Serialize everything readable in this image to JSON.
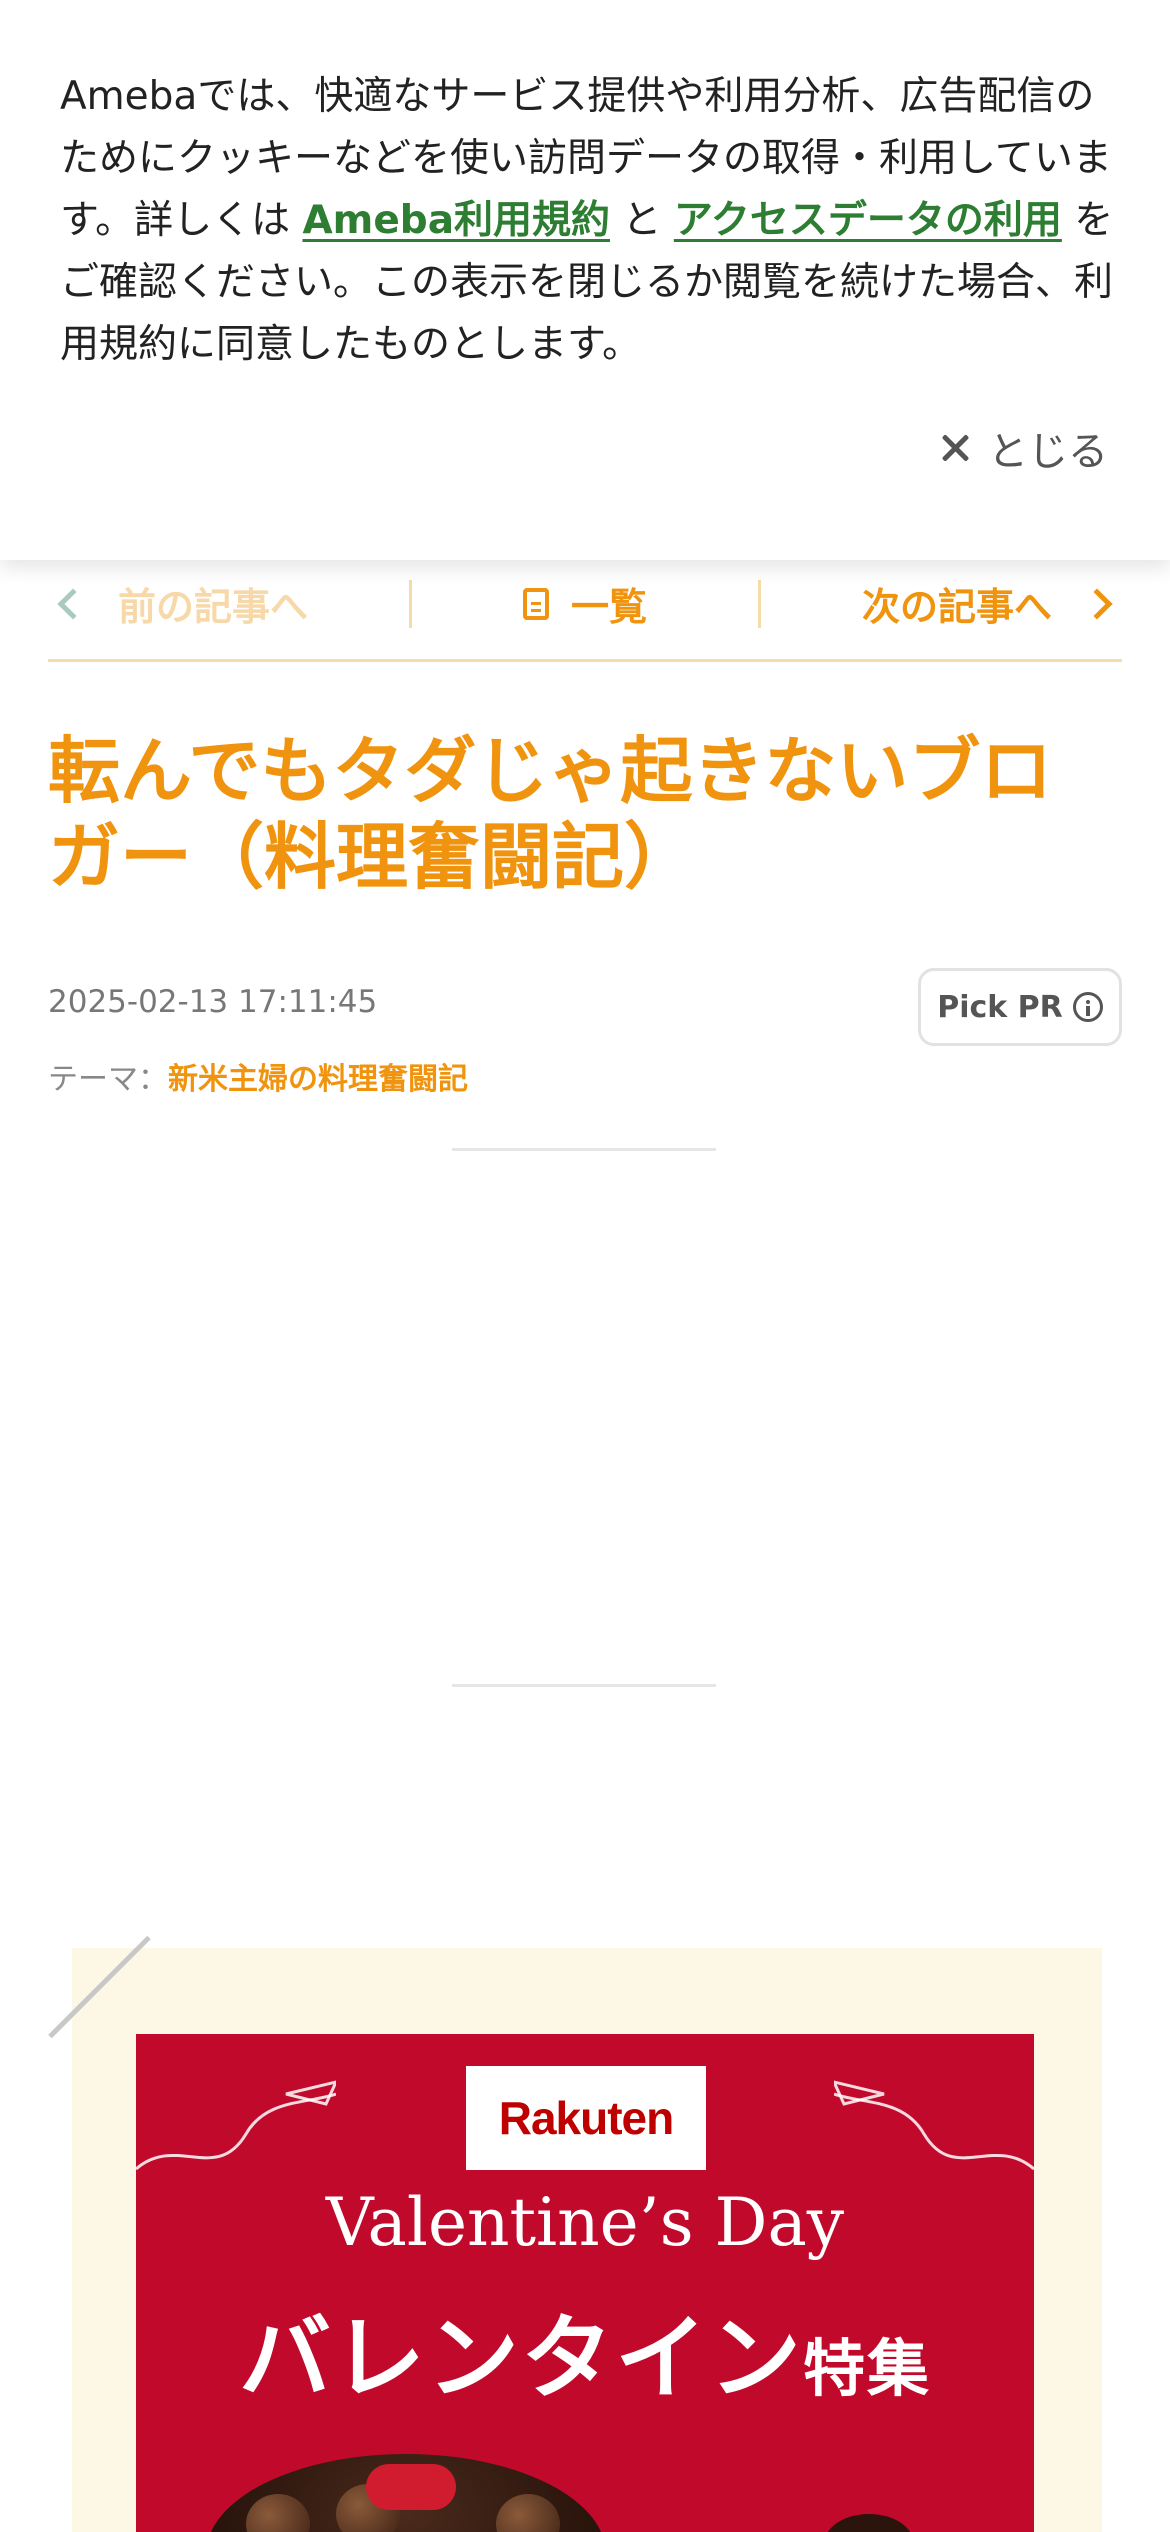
{
  "cookie_banner": {
    "text_before": "Amebaでは、快適なサービス提供や利用分析、広告配信のためにクッキーなどを使い訪問データの取得・利用しています。詳しくは ",
    "link_terms": "Ameba利用規約",
    "text_and": " と ",
    "link_access": "アクセスデータの利用",
    "text_after": " をご確認ください。この表示を閉じるか閲覧を続けた場合、利用規約に同意したものとします。",
    "close_label": "とじる",
    "link_color": "#2d7d32"
  },
  "article_nav": {
    "prev_label": "前の記事へ",
    "list_label": "一覧",
    "next_label": "次の記事へ"
  },
  "article": {
    "title": "転んでもタダじゃ起きないブロガー（料理奮闘記）",
    "date": "2025-02-13 17:11:45",
    "pick_pr_label": "Pick PR",
    "theme_label": "テーマ：",
    "theme_value": "新米主婦の料理奮闘記",
    "accent_color": "#f0940f"
  },
  "promo": {
    "logo_text": "Rakuten",
    "title_en": "Valentine’s Day",
    "title_jp_main": "バレンタイン",
    "title_jp_suffix": "特集",
    "banner_color": "#c10a2b"
  }
}
